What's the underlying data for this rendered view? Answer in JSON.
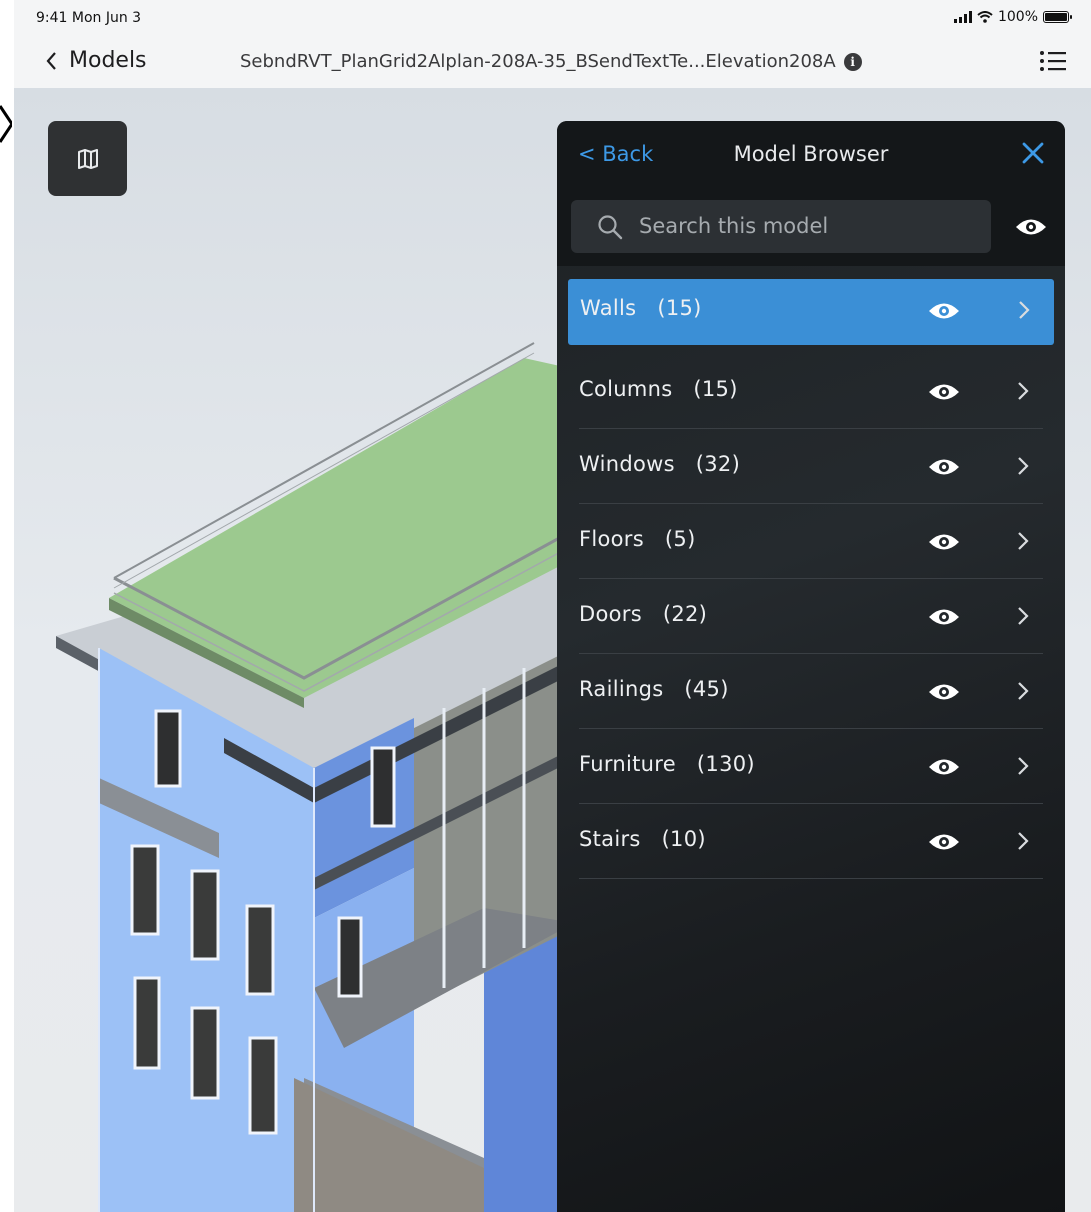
{
  "status_bar": {
    "time": "9:41  Mon Jun 3",
    "battery": "100%",
    "icons": [
      "signal-icon",
      "wifi-icon",
      "battery-icon"
    ]
  },
  "nav": {
    "back_label": "Models",
    "title": "SebndRVT_PlanGrid2Alplan-208A-35_BSendTextTe...Elevation208A",
    "icons": [
      "chevron-left-icon",
      "info-icon",
      "list-icon"
    ]
  },
  "viewport": {
    "map_button_icon": "map-icon"
  },
  "model_browser": {
    "back_label": "< Back",
    "title": "Model Browser",
    "search_placeholder": "Search this model",
    "items": [
      {
        "label": "Walls   (15)",
        "selected": true
      },
      {
        "label": "Columns   (15)",
        "selected": false
      },
      {
        "label": "Windows   (32)",
        "selected": false
      },
      {
        "label": "Floors   (5)",
        "selected": false
      },
      {
        "label": "Doors   (22)",
        "selected": false
      },
      {
        "label": "Railings   (45)",
        "selected": false
      },
      {
        "label": "Furniture   (130)",
        "selected": false
      },
      {
        "label": "Stairs   (10)",
        "selected": false
      }
    ]
  },
  "colors": {
    "accent": "#3b8fd6",
    "panel": "#1d2124",
    "building_blue": "#8fb8f4",
    "roof_green": "#9cc98f"
  }
}
